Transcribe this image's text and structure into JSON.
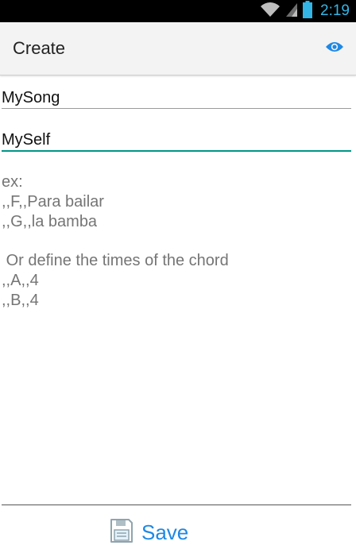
{
  "status_bar": {
    "time": "2:19",
    "icons": [
      "wifi-icon",
      "signal-icon",
      "battery-icon"
    ],
    "time_color": "#33b5e5"
  },
  "action_bar": {
    "title": "Create",
    "preview_icon": "eye-icon",
    "accent": "#1e88e5"
  },
  "form": {
    "title_value": "MySong",
    "author_value": "MySelf",
    "lyrics_hint": "ex:\n,,F,,Para bailar\n,,G,,la bamba\n\n Or define the times of the chord\n,,A,,4\n,,B,,4",
    "focus_color": "#009688"
  },
  "footer": {
    "save_label": "Save",
    "save_icon": "floppy-disk-icon"
  }
}
